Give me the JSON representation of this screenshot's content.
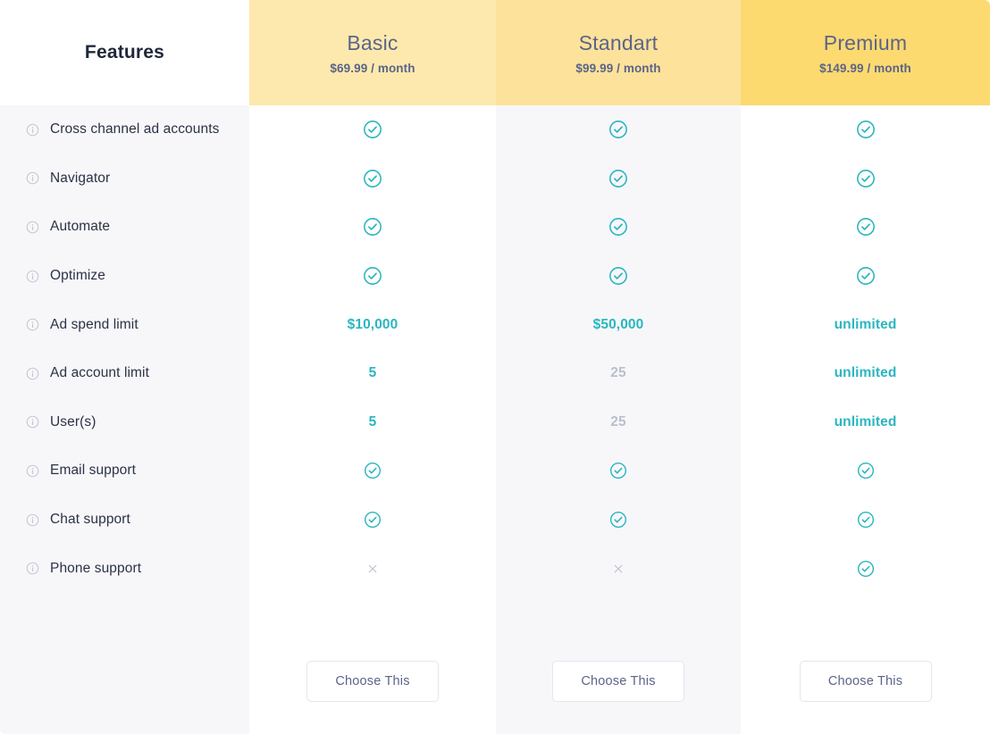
{
  "table": {
    "features_header": "Features",
    "cta_label": "Choose This",
    "info_icon": "info-circle-icon",
    "check_icon": "check-circle-icon",
    "cross_icon": "close-x-icon"
  },
  "colors": {
    "teal": "#2bb6bf",
    "muted": "#b9bfcc",
    "header_basic": "#fde9ad",
    "header_standart": "#fce29a",
    "header_premium": "#fcda70",
    "column_tint": "#f7f7fa",
    "text_dark": "#2b3245",
    "text_slate": "#5c6489"
  },
  "plans": [
    {
      "name": "Basic",
      "price": "$69.99 / month"
    },
    {
      "name": "Standart",
      "price": "$99.99 / month"
    },
    {
      "name": "Premium",
      "price": "$149.99 / month"
    }
  ],
  "features": [
    {
      "label": "Cross channel ad accounts",
      "basic": "check",
      "standart": "check",
      "premium": "check"
    },
    {
      "label": "Navigator",
      "basic": "check",
      "standart": "check",
      "premium": "check"
    },
    {
      "label": "Automate",
      "basic": "check",
      "standart": "check",
      "premium": "check"
    },
    {
      "label": "Optimize",
      "basic": "check",
      "standart": "check",
      "premium": "check"
    },
    {
      "label": "Ad spend limit",
      "basic": "$10,000",
      "standart": "$50,000",
      "premium": "unlimited"
    },
    {
      "label": "Ad account limit",
      "basic": "5",
      "standart": "25",
      "premium": "unlimited"
    },
    {
      "label": "User(s)",
      "basic": "5",
      "standart": "25",
      "premium": "unlimited"
    },
    {
      "label": "Email support",
      "basic": "check",
      "standart": "check",
      "premium": "check"
    },
    {
      "label": "Chat support",
      "basic": "check",
      "standart": "check",
      "premium": "check"
    },
    {
      "label": "Phone support",
      "basic": "cross",
      "standart": "cross",
      "premium": "check"
    }
  ],
  "value_styles": {
    "muted_cells": [
      {
        "row": 5,
        "plan": "standart"
      },
      {
        "row": 6,
        "plan": "standart"
      }
    ]
  }
}
